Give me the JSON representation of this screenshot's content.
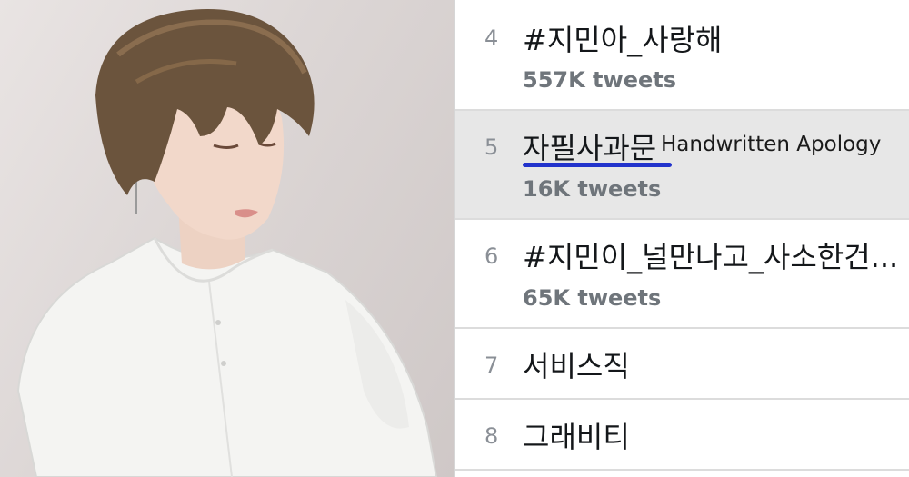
{
  "photo": {
    "alt_subject": "photo-portrait"
  },
  "trends": {
    "items": [
      {
        "rank": "4",
        "topic": "#지민아_사랑해",
        "count": "557K tweets"
      },
      {
        "rank": "5",
        "topic": "자필사과문",
        "translation": "Handwritten Apology",
        "count": "16K tweets",
        "highlighted": true
      },
      {
        "rank": "6",
        "topic": "#지민이_널만나고_사소한건...",
        "count": "65K tweets"
      },
      {
        "rank": "7",
        "topic": "서비스직"
      },
      {
        "rank": "8",
        "topic": "그래비티"
      }
    ]
  },
  "colors": {
    "underline": "#2233cc",
    "highlight": "#e7e7e7"
  }
}
